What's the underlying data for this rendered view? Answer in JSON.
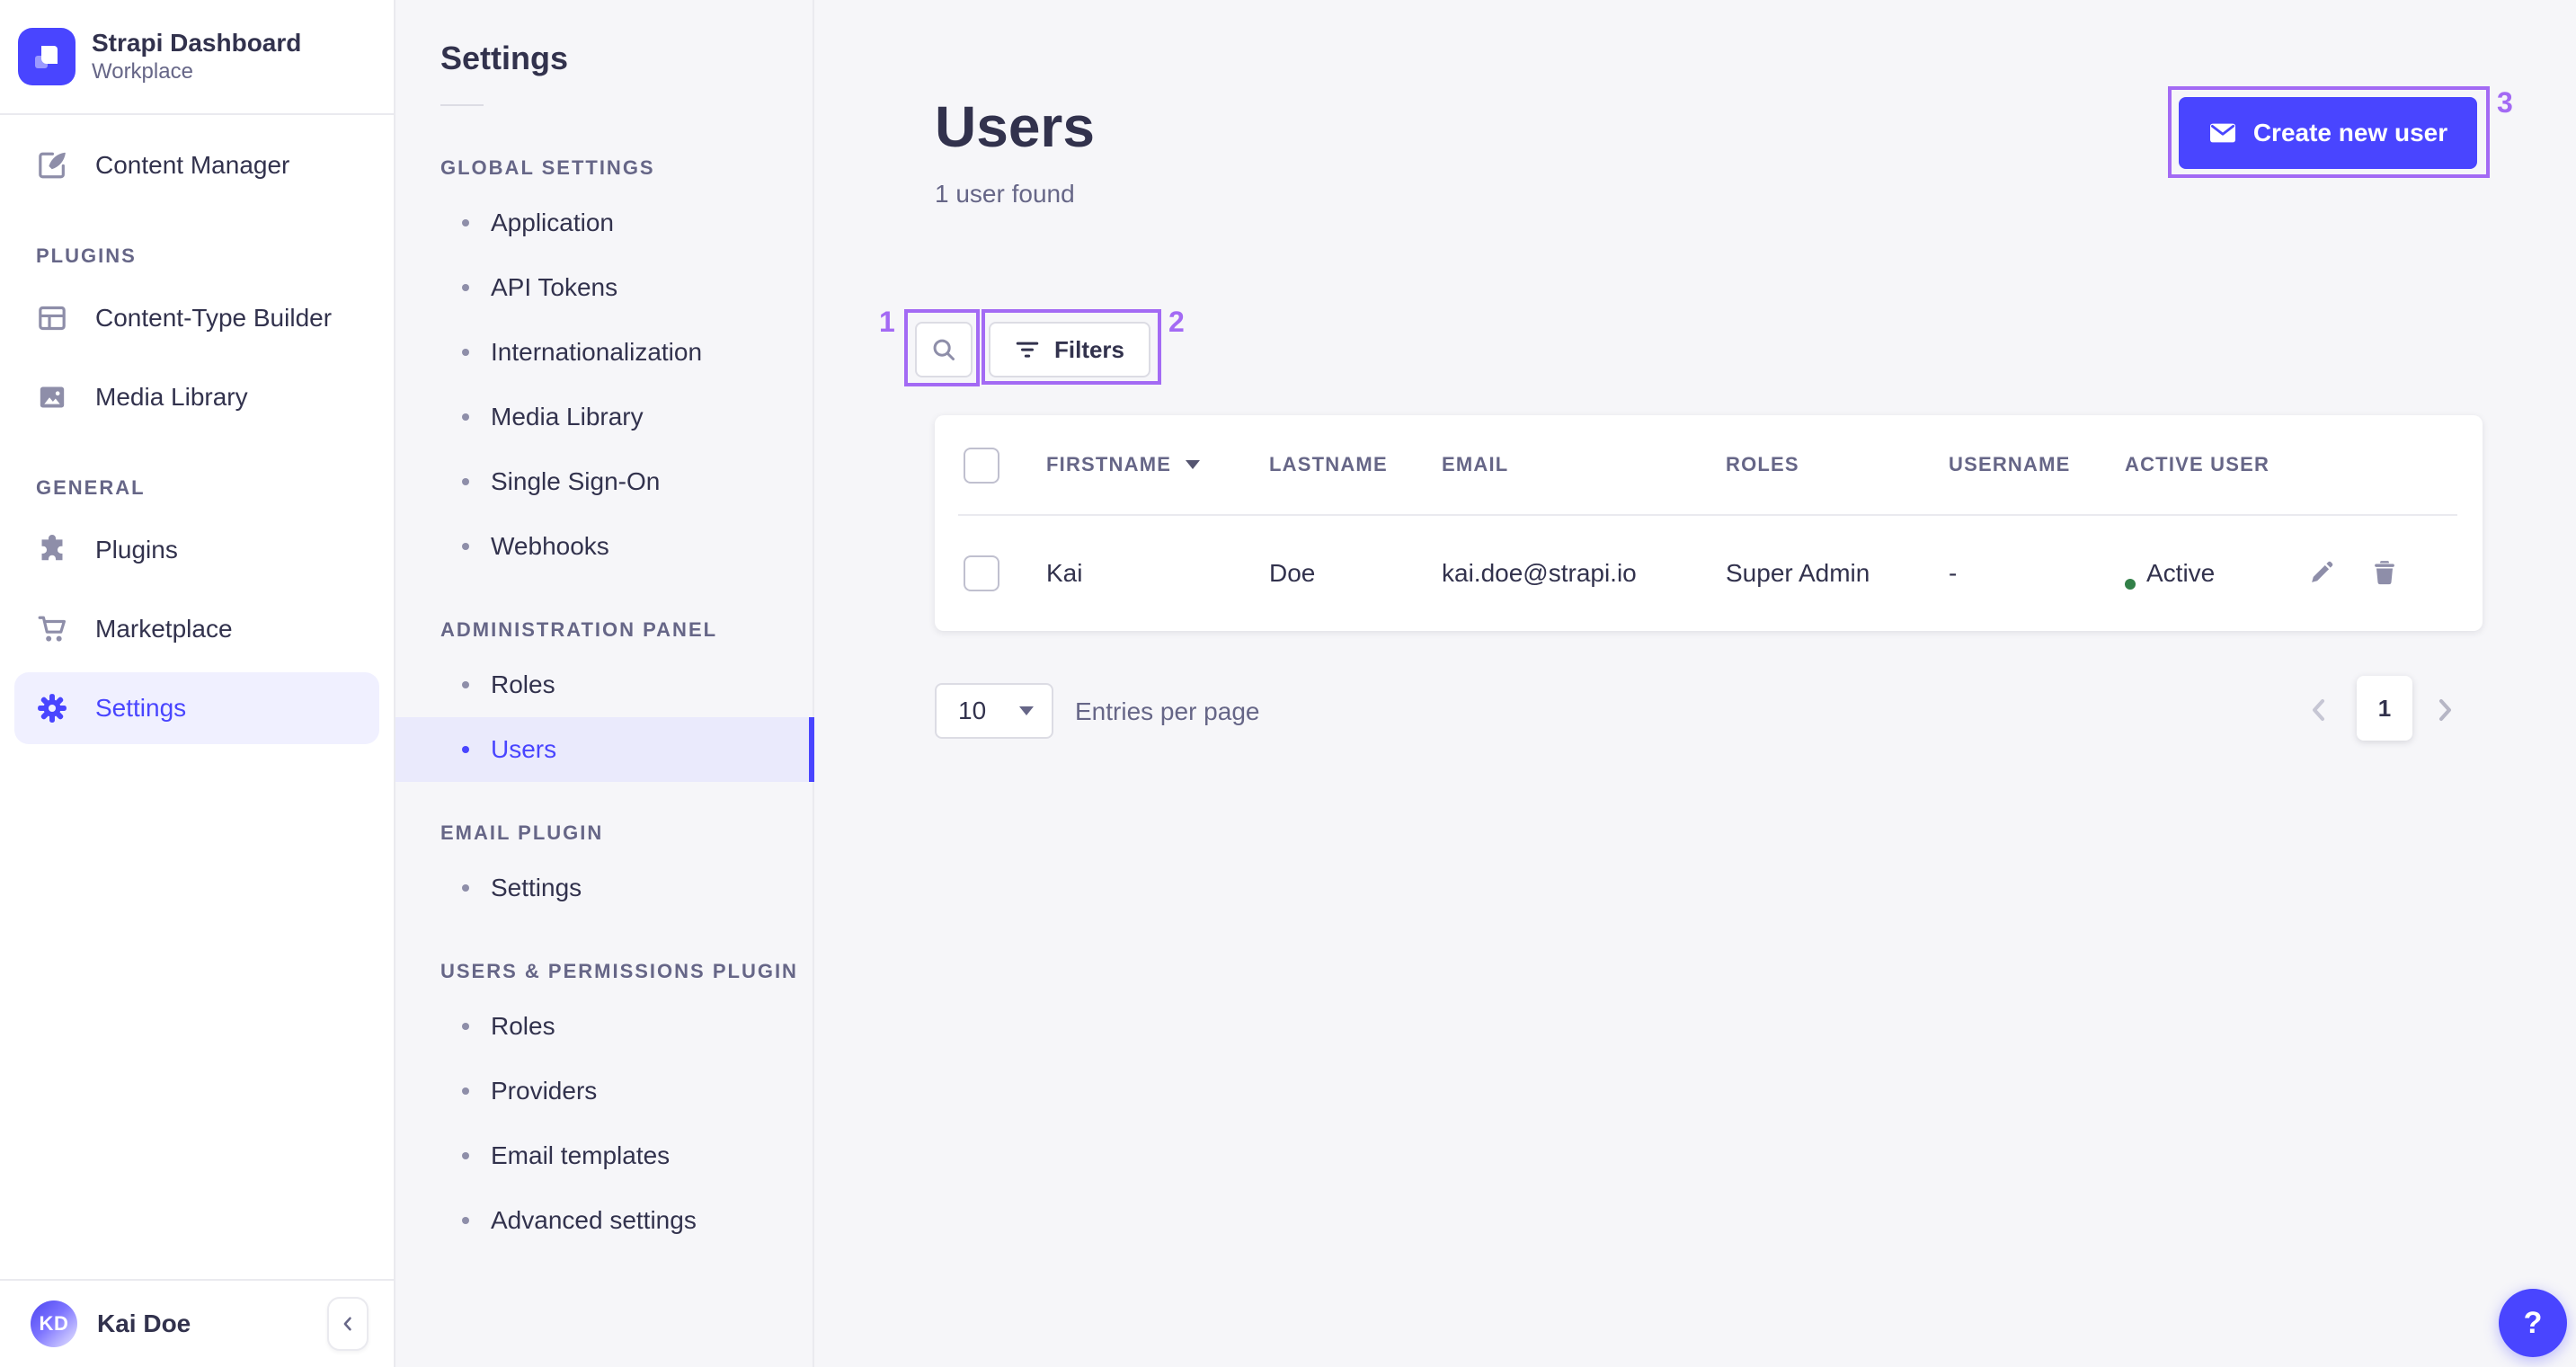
{
  "app": {
    "title": "Strapi Dashboard",
    "subtitle": "Workplace"
  },
  "sidebar": {
    "content_manager": "Content Manager",
    "sections": [
      {
        "label": "PLUGINS",
        "items": [
          "Content-Type Builder",
          "Media Library"
        ]
      },
      {
        "label": "GENERAL",
        "items": [
          "Plugins",
          "Marketplace",
          "Settings"
        ]
      }
    ],
    "active_item": "Settings",
    "user": {
      "initials": "KD",
      "name": "Kai Doe"
    }
  },
  "subnav": {
    "title": "Settings",
    "sections": [
      {
        "label": "GLOBAL SETTINGS",
        "items": [
          "Application",
          "API Tokens",
          "Internationalization",
          "Media Library",
          "Single Sign-On",
          "Webhooks"
        ]
      },
      {
        "label": "ADMINISTRATION PANEL",
        "items": [
          "Roles",
          "Users"
        ]
      },
      {
        "label": "EMAIL PLUGIN",
        "items": [
          "Settings"
        ]
      },
      {
        "label": "USERS & PERMISSIONS PLUGIN",
        "items": [
          "Roles",
          "Providers",
          "Email templates",
          "Advanced settings"
        ]
      }
    ],
    "active_item": "Users"
  },
  "main": {
    "title": "Users",
    "subtitle": "1 user found",
    "create_button": "Create new user",
    "filters_button": "Filters",
    "table": {
      "headers": [
        "FIRSTNAME",
        "LASTNAME",
        "EMAIL",
        "ROLES",
        "USERNAME",
        "ACTIVE USER"
      ],
      "rows": [
        {
          "firstname": "Kai",
          "lastname": "Doe",
          "email": "kai.doe@strapi.io",
          "roles": "Super Admin",
          "username": "-",
          "active_label": "Active"
        }
      ]
    },
    "pagination": {
      "page_size": "10",
      "entries_label": "Entries per page",
      "current_page": "1"
    }
  },
  "annotations": {
    "marks": [
      "1",
      "2",
      "3"
    ]
  },
  "help_button": "?",
  "colors": {
    "primary": "#4945ff",
    "primary_light": "#f0f0ff",
    "success": "#328048",
    "annotation": "#a36af4",
    "text_dark": "#32324d",
    "text_gray": "#666687"
  }
}
